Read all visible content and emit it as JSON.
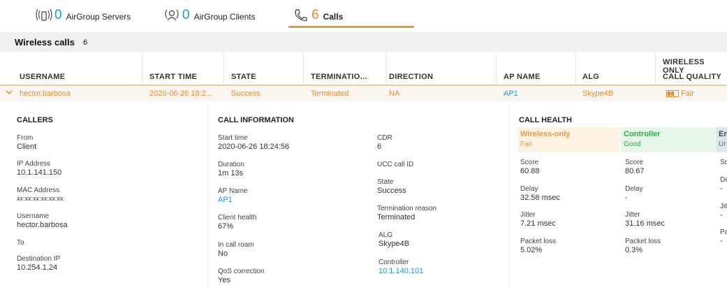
{
  "tabs": [
    {
      "count": "0",
      "label": "AirGroup Servers",
      "icon": "airgroup-servers-icon"
    },
    {
      "count": "0",
      "label": "AirGroup Clients",
      "icon": "airgroup-clients-icon"
    },
    {
      "count": "6",
      "label": "Calls",
      "icon": "phone-icon"
    }
  ],
  "section": {
    "title": "Wireless calls",
    "count": "6"
  },
  "columns": {
    "username": "USERNAME",
    "start_time": "START TIME",
    "state": "STATE",
    "termination": "TERMINATIO...",
    "direction": "DIRECTION",
    "ap_name": "AP NAME",
    "alg": "ALG",
    "group_label": "WIRELESS ONLY",
    "call_quality": "CALL QUALITY"
  },
  "row": {
    "username": "hector.barbosa",
    "start_time": "2020-06-26 18:2...",
    "state": "Success",
    "termination": "Terminated",
    "direction": "NA",
    "ap_name": "AP1",
    "alg": "Skype4B",
    "call_quality": "Fair"
  },
  "callers": {
    "title": "CALLERS",
    "from_label": "From",
    "from_value": "Client",
    "ip_label": "IP Address",
    "ip_value": "10.1.141.150",
    "mac_label": "MAC Address",
    "mac_value": "xx:xx:xx:xx:xx:xx",
    "username_label": "Username",
    "username_value": "hector.barbosa",
    "to_label": "To",
    "dest_ip_label": "Destination IP",
    "dest_ip_value": "10.254.1.24"
  },
  "call_info": {
    "title": "CALL INFORMATION",
    "start_time_label": "Start time",
    "start_time_value": "2020-06-26 18:24:56",
    "duration_label": "Duration",
    "duration_value": "1m 13s",
    "ap_name_label": "AP Name",
    "ap_name_value": "AP1",
    "client_health_label": "Client health",
    "client_health_value": "67%",
    "in_call_roam_label": "In call roam",
    "in_call_roam_value": "No",
    "qos_label": "QoS correction",
    "qos_value": "Yes",
    "cdr_label": "CDR",
    "cdr_value": "6",
    "ucc_label": "UCC call ID",
    "state_label": "State",
    "state_value": "Success",
    "term_reason_label": "Termination reason",
    "term_reason_value": "Terminated",
    "alg_label": "ALG",
    "alg_value": "Skype4B",
    "controller_label": "Controller",
    "controller_value": "10.1.140.101"
  },
  "call_health": {
    "title": "CALL HEALTH",
    "wireless": {
      "title": "Wireless-only",
      "status": "Fair",
      "score_label": "Score",
      "score": "60.88",
      "delay_label": "Delay",
      "delay": "32.58 msec",
      "jitter_label": "Jitter",
      "jitter": "7.21 msec",
      "loss_label": "Packet loss",
      "loss": "5.02%"
    },
    "controller": {
      "title": "Controller",
      "status": "Good",
      "score_label": "Score",
      "score": "80.67",
      "delay_label": "Delay",
      "delay": "-",
      "jitter_label": "Jitter",
      "jitter": "31.16 msec",
      "loss_label": "Packet loss",
      "loss": "0.3%"
    },
    "third": {
      "title": "En",
      "status": "Ur",
      "score_label": "Sc",
      "delay_label": "De",
      "delay": "-",
      "jitter_label": "Jit",
      "jitter": "-",
      "loss_label": "Pa",
      "loss": "-"
    }
  },
  "colors": {
    "accent_orange": "#e68a2e",
    "link_blue": "#1b9ad6",
    "good_green": "#2ea84a"
  }
}
